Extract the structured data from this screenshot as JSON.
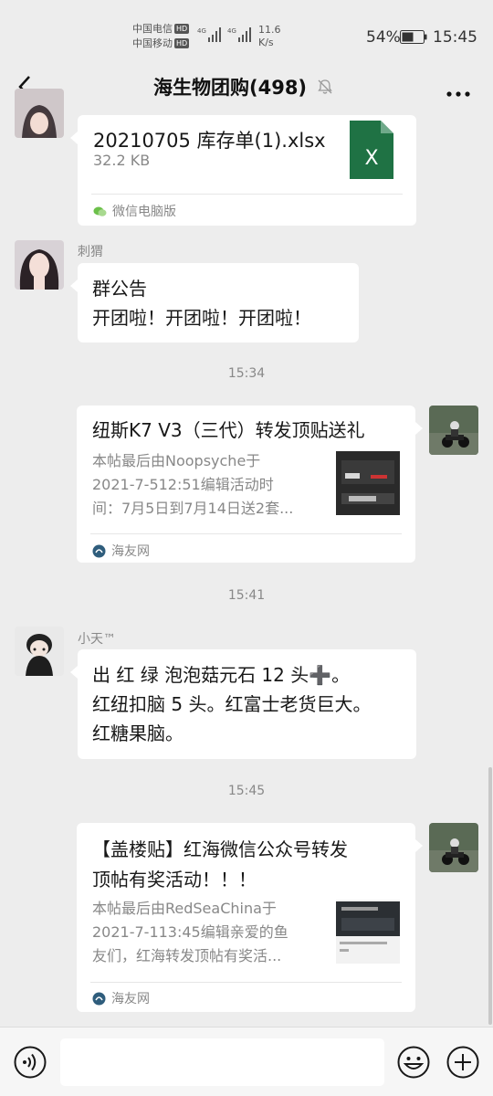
{
  "status_bar": {
    "carrier1": "中国电信",
    "carrier2": "中国移动",
    "hd": "HD",
    "net_speed_value": "11.6",
    "net_speed_unit": "K/s",
    "battery": "54%",
    "time": "15:45"
  },
  "nav": {
    "title": "海生物团购(498)"
  },
  "messages": {
    "file": {
      "name": "20210705 库存单(1).xlsx",
      "size": "32.2 KB",
      "source": "微信电脑版",
      "icon_letter": "X"
    },
    "notice": {
      "sender": "刺猬",
      "line1": "群公告",
      "line2": "开团啦！开团啦！开团啦！"
    },
    "time1": "15:34",
    "card1": {
      "title": "纽斯K7 V3（三代）转发顶贴送礼",
      "desc1": "本帖最后由Noopsyche于",
      "desc2": "2021-7-512:51编辑活动时",
      "desc3": "间：7月5日到7月14日送2套...",
      "source": "海友网"
    },
    "time2": "15:41",
    "text_msg": {
      "sender": "小天™",
      "line1": "出   红 绿 泡泡菇元石 12 头➕。",
      "line2": "红纽扣脑 5 头。红富士老货巨大。",
      "line3": "红糖果脑。"
    },
    "time3": "15:45",
    "card2": {
      "title1": "【盖楼贴】红海微信公众号转发",
      "title2": "顶帖有奖活动！！！",
      "desc1": "本帖最后由RedSeaChina于",
      "desc2": "2021-7-113:45编辑亲爱的鱼",
      "desc3": "友们，红海转发顶帖有奖活...",
      "source": "海友网"
    }
  },
  "input": {
    "placeholder": ""
  },
  "colors": {
    "background": "#ededed",
    "bubble": "#ffffff",
    "excel_green": "#1f7244"
  }
}
